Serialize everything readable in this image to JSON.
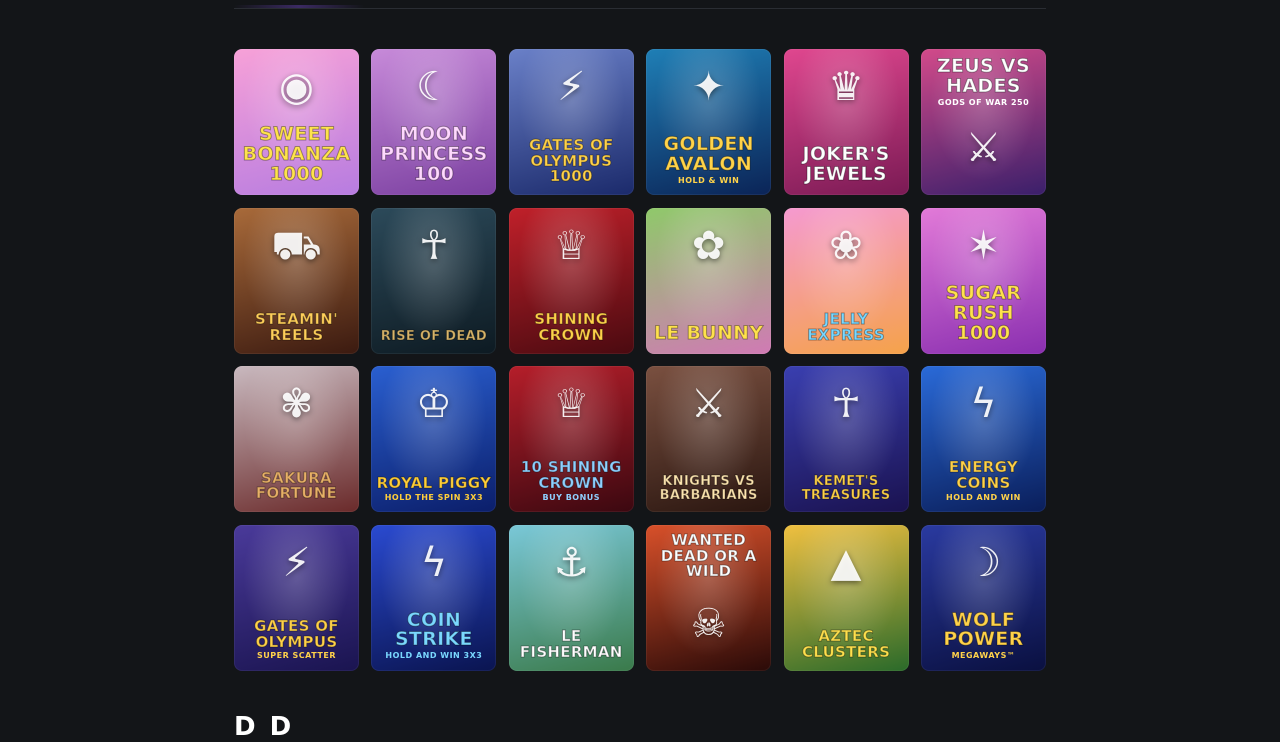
{
  "games": [
    {
      "name": "game-sweet-bonanza-1000",
      "title": "Sweet Bonanza 1000",
      "icon": "candy-icon",
      "glyph": "◉",
      "bg": [
        "#f7a1d8",
        "#b77ce0"
      ],
      "color": "#ffe34d",
      "size": ""
    },
    {
      "name": "game-moon-princess-100",
      "title": "Moon Princess 100",
      "icon": "princess-icon",
      "glyph": "☾",
      "bg": [
        "#c78ad9",
        "#7a3fa0"
      ],
      "color": "#ffd8ff",
      "size": ""
    },
    {
      "name": "game-gates-of-olympus-1000",
      "title": "Gates of Olympus 1000",
      "icon": "zeus-icon",
      "glyph": "⚡",
      "bg": [
        "#6a80c8",
        "#1b2a6b"
      ],
      "color": "#ffd24a",
      "size": "small"
    },
    {
      "name": "game-golden-avalon",
      "title": "Golden Avalon",
      "icon": "sorceress-icon",
      "glyph": "✦",
      "bg": [
        "#1f7fb6",
        "#0b2457"
      ],
      "color": "#ffd34a",
      "size": "",
      "sub": "Hold & Win"
    },
    {
      "name": "game-jokers-jewels",
      "title": "Joker's Jewels",
      "icon": "joker-mask-icon",
      "glyph": "♛",
      "bg": [
        "#e0478f",
        "#7a1a54"
      ],
      "color": "#ffffff",
      "size": ""
    },
    {
      "name": "game-zeus-vs-hades",
      "title": "Zeus vs Hades",
      "icon": "gods-icon",
      "glyph": "⚔",
      "bg": [
        "#d24a8a",
        "#3a1f6a"
      ],
      "color": "#ffffff",
      "size": "",
      "sub": "Gods of War 250",
      "top": true
    },
    {
      "name": "game-steamin-reels",
      "title": "Steamin' Reels",
      "icon": "train-icon",
      "glyph": "⛟",
      "bg": [
        "#a86a3a",
        "#3b1a10"
      ],
      "color": "#ffcf5a",
      "size": "small"
    },
    {
      "name": "game-rise-of-dead",
      "title": "Rise of Dead",
      "icon": "anubis-icon",
      "glyph": "☥",
      "bg": [
        "#2c4a5a",
        "#0d1a22"
      ],
      "color": "#d8b56a",
      "size": "tiny"
    },
    {
      "name": "game-shining-crown",
      "title": "Shining Crown",
      "icon": "crown-icon",
      "glyph": "♕",
      "bg": [
        "#c0202a",
        "#4a0a10"
      ],
      "color": "#ffd24a",
      "size": "small"
    },
    {
      "name": "game-le-bunny",
      "title": "Le Bunny",
      "icon": "bunny-icon",
      "glyph": "✿",
      "bg": [
        "#8fc96a",
        "#d07ab4"
      ],
      "color": "#ffe14d",
      "size": ""
    },
    {
      "name": "game-jelly-express",
      "title": "Jelly Express",
      "icon": "candy-train-icon",
      "glyph": "❀",
      "bg": [
        "#f59ad0",
        "#f5a24a"
      ],
      "color": "#7ad8ff",
      "size": "small"
    },
    {
      "name": "game-sugar-rush-1000",
      "title": "Sugar Rush 1000",
      "icon": "candy-icon",
      "glyph": "✶",
      "bg": [
        "#e27ad8",
        "#8a2fb0"
      ],
      "color": "#ffe14d",
      "size": ""
    },
    {
      "name": "game-sakura-fortune",
      "title": "Sakura Fortune",
      "icon": "geisha-icon",
      "glyph": "✾",
      "bg": [
        "#c9b9bf",
        "#6a2a2a"
      ],
      "color": "#e8b067",
      "size": "small"
    },
    {
      "name": "game-royal-piggy",
      "title": "Royal Piggy",
      "icon": "piggy-bank-icon",
      "glyph": "♔",
      "bg": [
        "#2a5fd0",
        "#0b1e6a"
      ],
      "color": "#ffcf3a",
      "size": "small",
      "sub": "Hold the Spin 3x3"
    },
    {
      "name": "game-10-shining-crown-buy-bonus",
      "title": "10 Shining Crown",
      "icon": "crown-icon",
      "glyph": "♕",
      "bg": [
        "#b51e2a",
        "#3b0810"
      ],
      "color": "#8fd0ff",
      "size": "small",
      "sub": "Buy Bonus"
    },
    {
      "name": "game-knights-vs-barbarians",
      "title": "Knights vs Barbarians",
      "icon": "warriors-icon",
      "glyph": "⚔",
      "bg": [
        "#7a5040",
        "#2a1610"
      ],
      "color": "#ffe6b0",
      "size": "tiny"
    },
    {
      "name": "game-kemets-treasures",
      "title": "Kemet's Treasures",
      "icon": "pharaoh-icon",
      "glyph": "☥",
      "bg": [
        "#3a3fb0",
        "#1a1250"
      ],
      "color": "#ffd24a",
      "size": "tiny"
    },
    {
      "name": "game-energy-coins",
      "title": "Energy Coins",
      "icon": "lightning-coin-icon",
      "glyph": "ϟ",
      "bg": [
        "#2a6ad8",
        "#0a1e5a"
      ],
      "color": "#ffd24a",
      "size": "small",
      "sub": "Hold and Win"
    },
    {
      "name": "game-gates-of-olympus-super-scatter",
      "title": "Gates of Olympus",
      "icon": "zeus-icon",
      "glyph": "⚡",
      "bg": [
        "#4a3a9a",
        "#1a1450"
      ],
      "color": "#ffd24a",
      "size": "small",
      "sub": "Super Scatter"
    },
    {
      "name": "game-coin-strike",
      "title": "Coin Strike",
      "icon": "lightning-coin-icon",
      "glyph": "ϟ",
      "bg": [
        "#2a4ad0",
        "#0a1450"
      ],
      "color": "#7ad8ff",
      "size": "",
      "sub": "Hold and Win 3x3"
    },
    {
      "name": "game-le-fisherman",
      "title": "Le Fisherman",
      "icon": "raccoon-icon",
      "glyph": "⚓",
      "bg": [
        "#7ac8d8",
        "#3a7a4a"
      ],
      "color": "#ffffff",
      "size": "small"
    },
    {
      "name": "game-wanted-dead-or-a-wild",
      "title": "Wanted Dead or a Wild",
      "icon": "cowboy-icon",
      "glyph": "☠",
      "bg": [
        "#d8502a",
        "#2a0a08"
      ],
      "color": "#ffffff",
      "size": "small",
      "top": true
    },
    {
      "name": "game-aztec-clusters",
      "title": "Aztec Clusters",
      "icon": "pyramid-icon",
      "glyph": "▲",
      "bg": [
        "#f0c040",
        "#2a6a2a"
      ],
      "color": "#ffe14d",
      "size": "small"
    },
    {
      "name": "game-wolf-power-megaways",
      "title": "Wolf Power",
      "icon": "wolf-icon",
      "glyph": "☽",
      "bg": [
        "#2a3aa0",
        "#0a1040"
      ],
      "color": "#ffd24a",
      "size": "",
      "sub": "Megaways™"
    }
  ],
  "section_heading": "D D"
}
